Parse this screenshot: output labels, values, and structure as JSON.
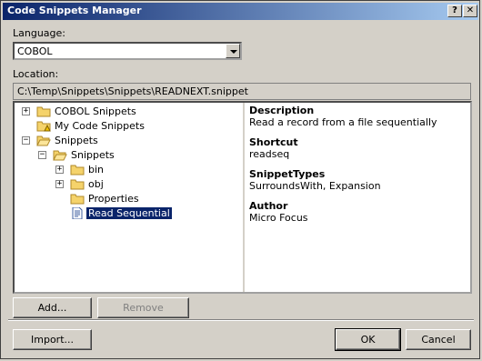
{
  "window": {
    "title": "Code Snippets Manager",
    "help_label": "?",
    "close_label": "✕"
  },
  "language": {
    "label": "Language:",
    "value": "COBOL"
  },
  "location": {
    "label": "Location:",
    "value": "C:\\Temp\\Snippets\\Snippets\\READNEXT.snippet"
  },
  "tree": {
    "nodes": [
      {
        "label": "COBOL Snippets",
        "expander": "+",
        "icon": "folder-icon"
      },
      {
        "label": "My Code Snippets",
        "icon": "folder-warning-icon"
      },
      {
        "label": "Snippets",
        "expander": "−",
        "icon": "folder-open-icon"
      },
      {
        "label": "Snippets",
        "expander": "−",
        "icon": "folder-open-icon"
      },
      {
        "label": "bin",
        "expander": "+",
        "icon": "folder-icon"
      },
      {
        "label": "obj",
        "expander": "+",
        "icon": "folder-icon"
      },
      {
        "label": "Properties",
        "icon": "folder-icon"
      },
      {
        "label": "Read Sequential",
        "icon": "snippet-file-icon",
        "selected": true
      }
    ]
  },
  "details": {
    "description_title": "Description",
    "description": "Read a record from a file sequentially",
    "shortcut_title": "Shortcut",
    "shortcut": "readseq",
    "types_title": "SnippetTypes",
    "types": "SurroundsWith, Expansion",
    "author_title": "Author",
    "author": "Micro Focus"
  },
  "buttons": {
    "add": "Add...",
    "remove": "Remove",
    "import": "Import...",
    "ok": "OK",
    "cancel": "Cancel"
  }
}
